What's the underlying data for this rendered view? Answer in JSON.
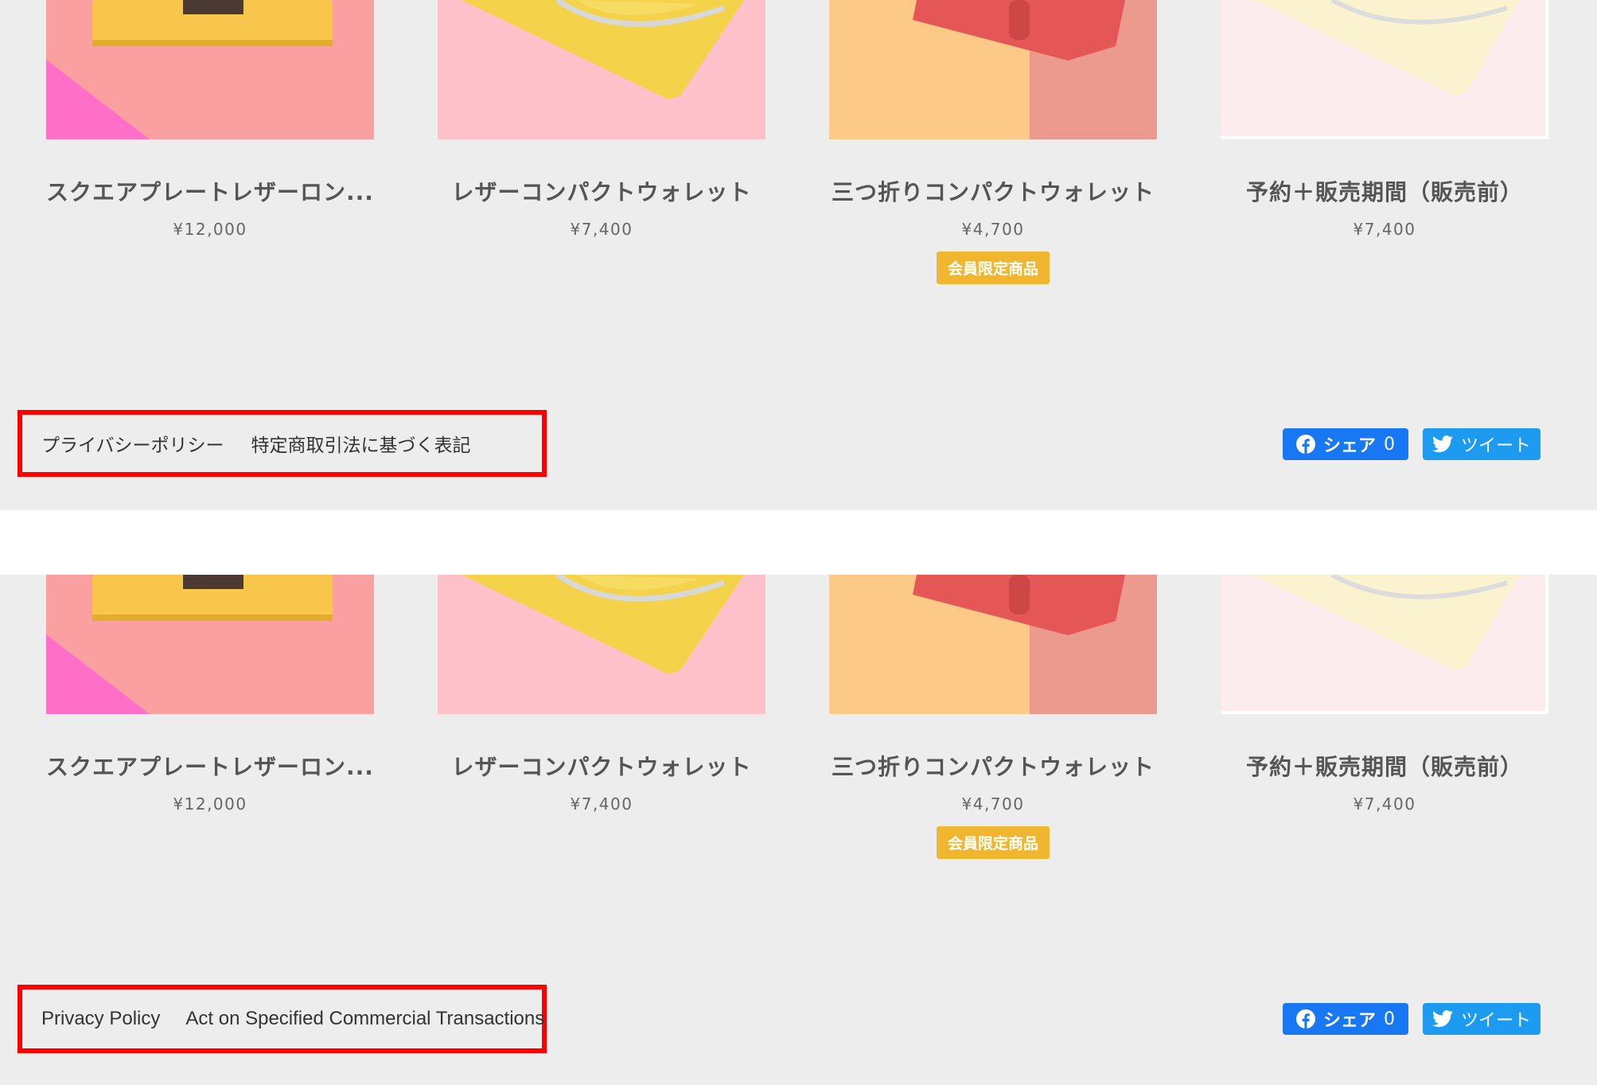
{
  "colors": {
    "background": "#ededed",
    "badge": "#f0b62f",
    "highlight": "#ff0000",
    "facebook": "#1877f2",
    "twitter": "#1d9bf0"
  },
  "top": {
    "products": [
      {
        "name": "スクエアプレートレザーロン...",
        "price": "¥12,000"
      },
      {
        "name": "レザーコンパクトウォレット",
        "price": "¥7,400"
      },
      {
        "name": "三つ折りコンパクトウォレット",
        "price": "¥4,700",
        "badge": "会員限定商品"
      },
      {
        "name": "予約＋販売期間（販売前）",
        "price": "¥7,400"
      }
    ],
    "footer": {
      "privacy": "プライバシーポリシー",
      "commercial": "特定商取引法に基づく表記"
    },
    "share": {
      "facebook_label": "シェア",
      "facebook_count": "0",
      "twitter_label": "ツイート"
    }
  },
  "bottom": {
    "products": [
      {
        "name": "スクエアプレートレザーロン...",
        "price": "¥12,000"
      },
      {
        "name": "レザーコンパクトウォレット",
        "price": "¥7,400"
      },
      {
        "name": "三つ折りコンパクトウォレット",
        "price": "¥4,700",
        "badge": "会員限定商品"
      },
      {
        "name": "予約＋販売期間（販売前）",
        "price": "¥7,400"
      }
    ],
    "footer": {
      "privacy": "Privacy Policy",
      "commercial": "Act on Specified Commercial Transactions"
    },
    "share": {
      "facebook_label": "シェア",
      "facebook_count": "0",
      "twitter_label": "ツイート"
    }
  }
}
